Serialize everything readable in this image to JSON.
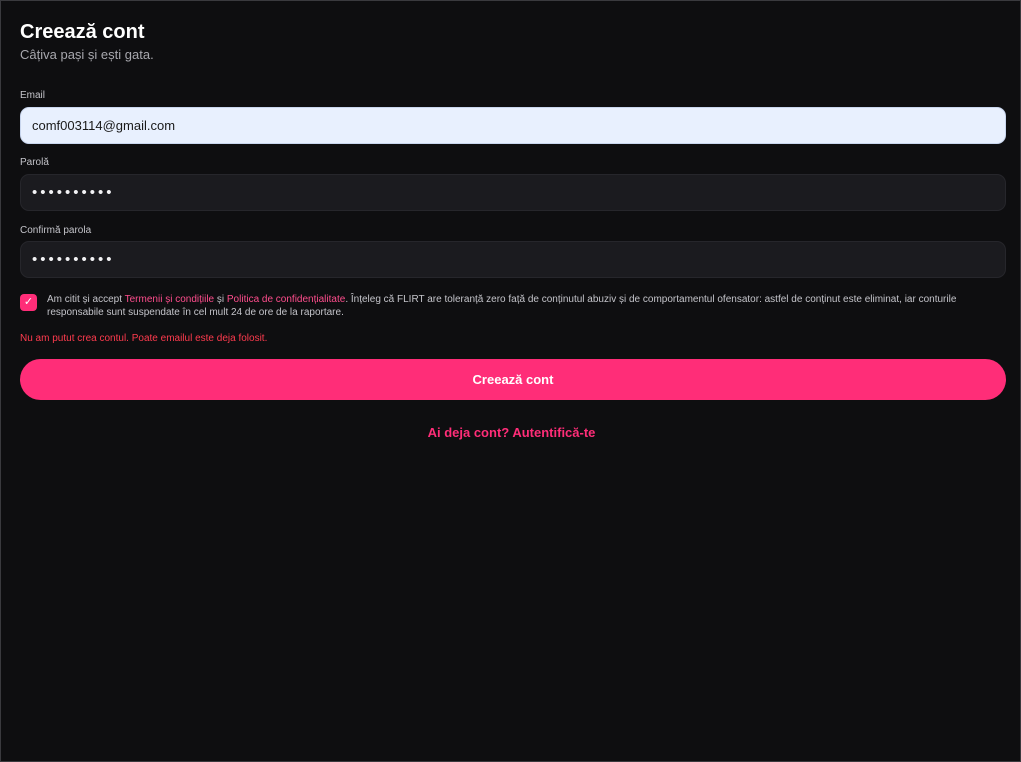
{
  "header": {
    "title": "Creează cont",
    "subtitle": "Câțiva pași și ești gata."
  },
  "form": {
    "email_label": "Email",
    "email_value": "comf003114@gmail.com",
    "password_label": "Parolă",
    "password_value": "••••••••••",
    "confirm_label": "Confirmă parola",
    "confirm_value": "••••••••••"
  },
  "consent": {
    "checked": true,
    "check_glyph": "✓",
    "prefix": "Am citit și accept ",
    "terms_link": "Termenii și condițiile",
    "and": " și ",
    "privacy_link": "Politica de confidențialitate",
    "rest": ". Înțeleg că FLIRT are toleranță zero față de conținutul abuziv și de comportamentul ofensator: astfel de conținut este eliminat, iar conturile responsabile sunt suspendate în cel mult 24 de ore de la raportare."
  },
  "error_message": "Nu am putut crea contul. Poate emailul este deja folosit.",
  "submit_label": "Creează cont",
  "signin_link": "Ai deja cont? Autentifică-te",
  "colors": {
    "background": "#0e0e10",
    "accent": "#ff2d78",
    "error": "#ff3b4e",
    "field": "#1b1b1f",
    "email_autofill": "#e8f0fe"
  }
}
